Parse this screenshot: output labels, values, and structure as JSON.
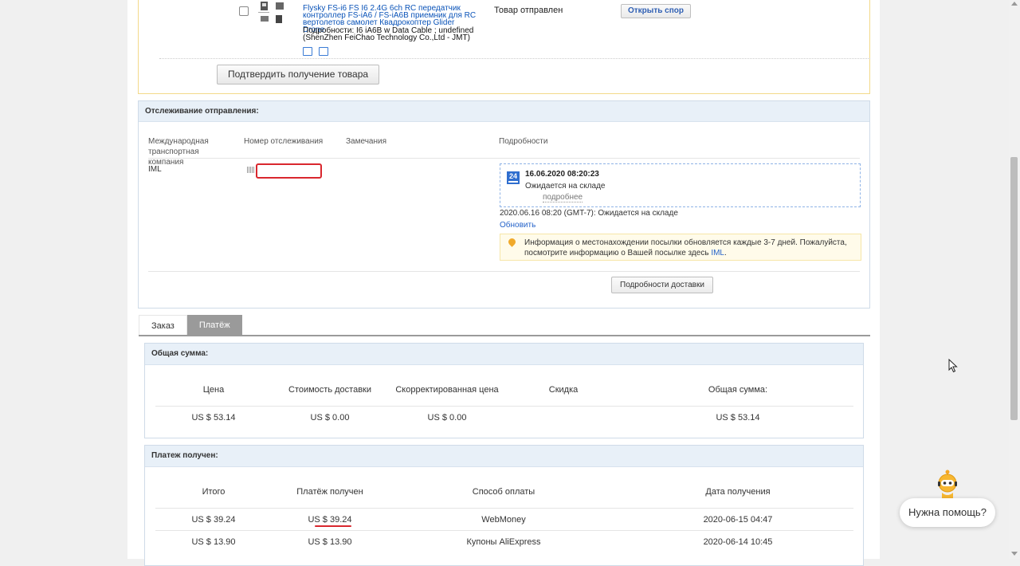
{
  "product": {
    "title": "Flysky FS-i6 FS I6 2.4G 6ch RC передатчик контроллер FS-iA6 / FS-iA6B приемник для RC вертолетов самолет Квадрокоптер Glider Drone",
    "details": "Подробности: I6 iA6B w Data Cable ; undefined (ShenZhen FeiChao Technology Co.,Ltd - JMT)",
    "status": "Товар отправлен",
    "dispute_button": "Открыть спор",
    "confirm_button": "Подтвердить получение товара"
  },
  "tracking": {
    "header": "Отслеживание отправления:",
    "columns": [
      "Международная транспортная компания",
      "Номер отслеживания",
      "Замечания",
      "Подробности"
    ],
    "carrier": "IML",
    "event": {
      "calendar_day": "24",
      "date": "16.06.2020 08:20:23",
      "status": "Ожидается на складе",
      "more_link": "подробнее"
    },
    "event_line": "2020.06.16 08:20 (GMT-7): Ожидается на складе",
    "refresh_link": "Обновить",
    "info_text": "Информация о местонахождении посылки обновляется каждые 3-7 дней. Пожалуйста, посмотрите информацию о Вашей посылке здесь",
    "info_link": "IML",
    "info_end": ".",
    "delivery_button": "Подробности доставки"
  },
  "tabs": [
    {
      "label": "Заказ",
      "active": false
    },
    {
      "label": "Платёж",
      "active": true
    }
  ],
  "total_panel": {
    "header": "Общая сумма:",
    "columns": [
      "Цена",
      "Стоимость доставки",
      "Скорректированная цена",
      "Скидка",
      "Общая сумма:"
    ],
    "row": [
      "US $ 53.14",
      "US $ 0.00",
      "US $ 0.00",
      "",
      "US $ 53.14"
    ]
  },
  "payment_panel": {
    "header": "Платеж получен:",
    "columns": [
      "Итого",
      "Платёж получен",
      "Способ оплаты",
      "Дата получения"
    ],
    "rows": [
      [
        "US $ 39.24",
        "US $ 39.24",
        "WebMoney",
        "2020-06-15 04:47"
      ],
      [
        "US $ 13.90",
        "US $ 13.90",
        "Купоны AliExpress",
        "2020-06-14 10:45"
      ]
    ]
  },
  "help_widget": {
    "label": "Нужна помощь?"
  },
  "colors": {
    "accent_link": "#2563c9",
    "highlight_red": "#d9272e",
    "panel_header": "#e8f0f8",
    "tab_active": "#9a9a9a"
  }
}
